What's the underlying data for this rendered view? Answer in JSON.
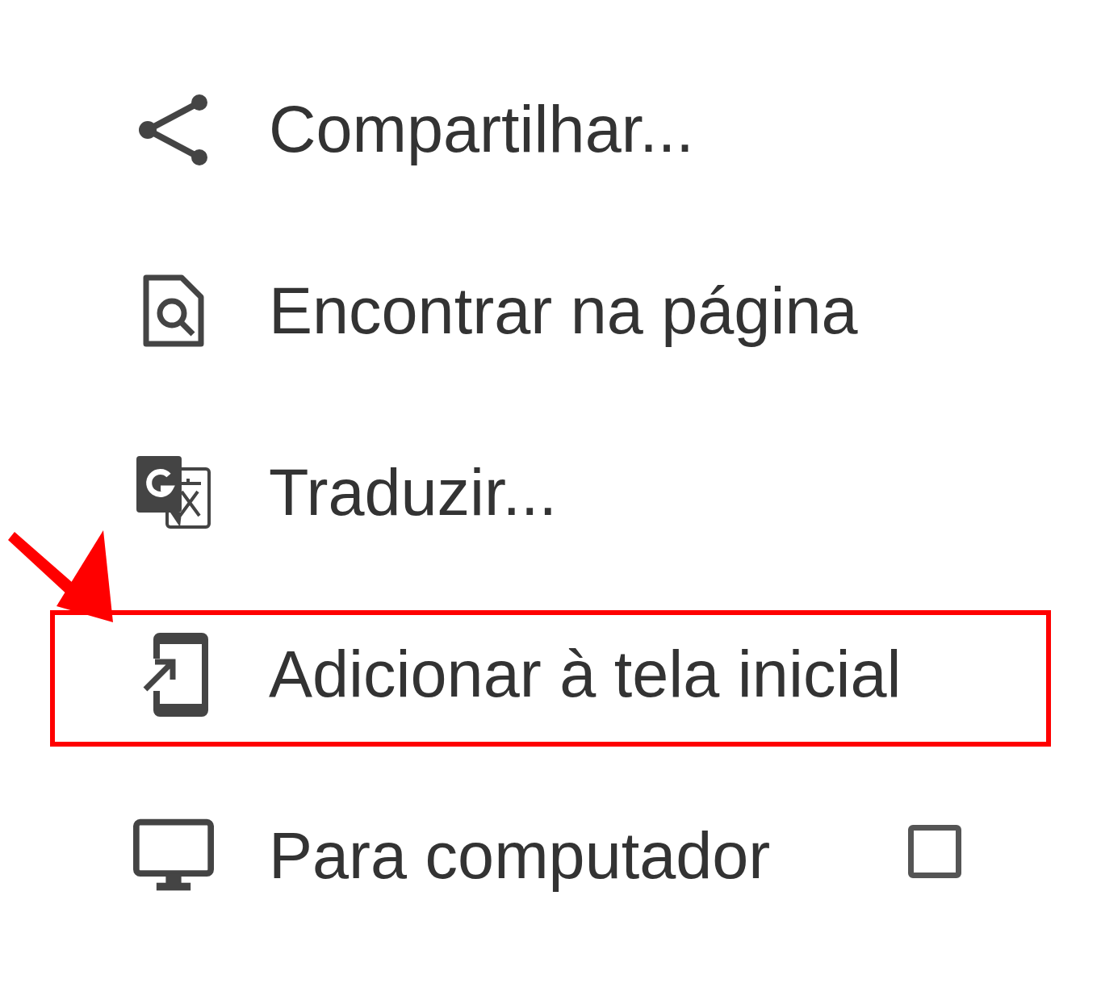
{
  "menu": {
    "items": [
      {
        "kind": "share",
        "label": "Compartilhar...",
        "highlighted": false
      },
      {
        "kind": "find",
        "label": "Encontrar na página",
        "highlighted": false
      },
      {
        "kind": "translate",
        "label": "Traduzir...",
        "highlighted": false
      },
      {
        "kind": "add-home",
        "label": "Adicionar à tela inicial",
        "highlighted": true
      },
      {
        "kind": "desktop",
        "label": "Para computador",
        "highlighted": false,
        "checked": false
      }
    ]
  }
}
